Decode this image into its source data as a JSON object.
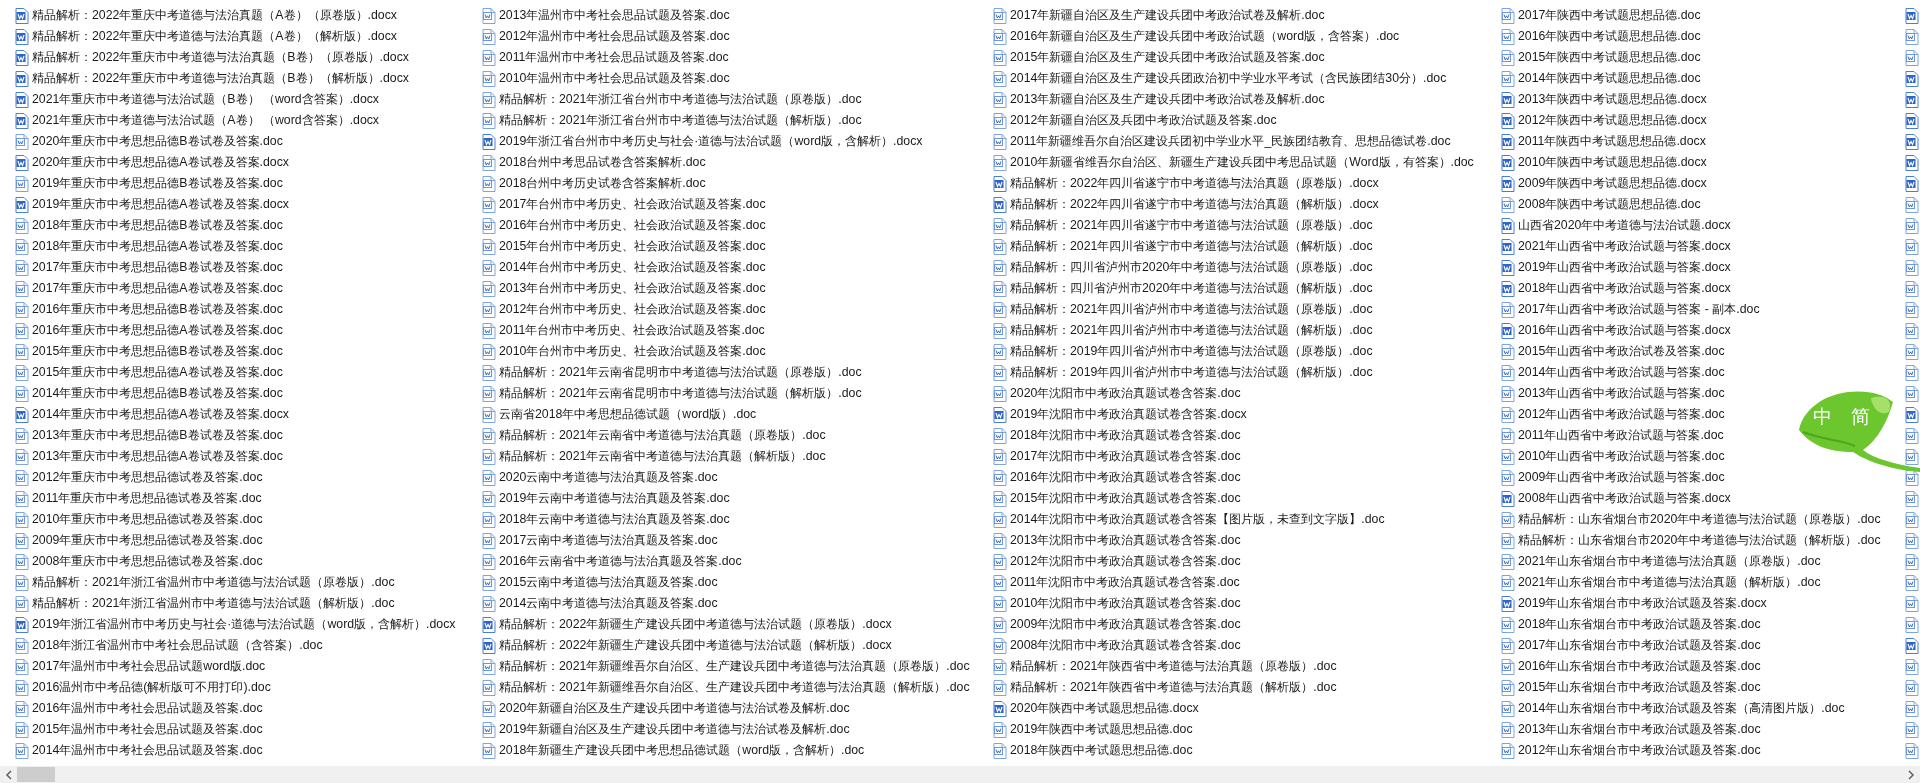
{
  "file_columns": [
    {
      "files": [
        {
          "name": "精品解析：2022年重庆中考道德与法治真题（A卷）（原卷版）.docx",
          "kind": "filled"
        },
        {
          "name": "精品解析：2022年重庆中考道德与法治真题（A卷）（解析版）.docx",
          "kind": "filled"
        },
        {
          "name": "精品解析：2022年重庆市中考道德与法治真题（B卷）（原卷版）.docx",
          "kind": "filled"
        },
        {
          "name": "精品解析：2022年重庆市中考道德与法治真题（B卷）（解析版）.docx",
          "kind": "filled"
        },
        {
          "name": "2021年重庆市中考道德与法治试题（B卷） （word含答案）.docx",
          "kind": "filled"
        },
        {
          "name": "2021年重庆市中考道德与法治试题（A卷） （word含答案）.docx",
          "kind": "filled"
        },
        {
          "name": "2020年重庆市中考思想品德B卷试卷及答案.doc",
          "kind": "outline"
        },
        {
          "name": "2020年重庆市中考思想品德A卷试卷及答案.docx",
          "kind": "filled"
        },
        {
          "name": "2019年重庆市中考思想品德B卷试卷及答案.doc",
          "kind": "outline"
        },
        {
          "name": "2019年重庆市中考思想品德A卷试卷及答案.docx",
          "kind": "filled"
        },
        {
          "name": "2018年重庆市中考思想品德B卷试卷及答案.doc",
          "kind": "outline"
        },
        {
          "name": "2018年重庆市中考思想品德A卷试卷及答案.doc",
          "kind": "outline"
        },
        {
          "name": "2017年重庆市中考思想品德B卷试卷及答案.doc",
          "kind": "outline"
        },
        {
          "name": "2017年重庆市中考思想品德A卷试卷及答案.doc",
          "kind": "outline"
        },
        {
          "name": "2016年重庆市中考思想品德B卷试卷及答案.doc",
          "kind": "outline"
        },
        {
          "name": "2016年重庆市中考思想品德A卷试卷及答案.doc",
          "kind": "outline"
        },
        {
          "name": "2015年重庆市中考思想品德B卷试卷及答案.doc",
          "kind": "outline"
        },
        {
          "name": "2015年重庆市中考思想品德A卷试卷及答案.doc",
          "kind": "outline"
        },
        {
          "name": "2014年重庆市中考思想品德B卷试卷及答案.doc",
          "kind": "outline"
        },
        {
          "name": "2014年重庆市中考思想品德A卷试卷及答案.docx",
          "kind": "filled"
        },
        {
          "name": "2013年重庆市中考思想品德B卷试卷及答案.doc",
          "kind": "outline"
        },
        {
          "name": "2013年重庆市中考思想品德A卷试卷及答案.doc",
          "kind": "outline"
        },
        {
          "name": "2012年重庆市中考思想品德试卷及答案.doc",
          "kind": "outline"
        },
        {
          "name": "2011年重庆市中考思想品德试卷及答案.doc",
          "kind": "outline"
        },
        {
          "name": "2010年重庆市中考思想品德试卷及答案.doc",
          "kind": "outline"
        },
        {
          "name": "2009年重庆市中考思想品德试卷及答案.doc",
          "kind": "outline"
        },
        {
          "name": "2008年重庆市中考思想品德试卷及答案.doc",
          "kind": "outline"
        },
        {
          "name": "精品解析：2021年浙江省温州市中考道德与法治试题（原卷版）.doc",
          "kind": "outline"
        },
        {
          "name": "精品解析：2021年浙江省温州市中考道德与法治试题（解析版）.doc",
          "kind": "outline"
        },
        {
          "name": "2019年浙江省温州市中考历史与社会·道德与法治试题（word版，含解析）.docx",
          "kind": "filled"
        },
        {
          "name": "2018年浙江省温州市中考社会思品试题（含答案）.doc",
          "kind": "outline"
        },
        {
          "name": "2017年温州市中考社会思品试题word版.doc",
          "kind": "outline"
        },
        {
          "name": "2016温州市中考品德(解析版可不用打印).doc",
          "kind": "outline"
        },
        {
          "name": "2016年温州市中考社会思品试题及答案.doc",
          "kind": "outline"
        },
        {
          "name": "2015年温州市中考社会思品试题及答案.doc",
          "kind": "outline"
        },
        {
          "name": "2014年温州市中考社会思品试题及答案.doc",
          "kind": "outline"
        }
      ]
    },
    {
      "files": [
        {
          "name": "2013年温州市中考社会思品试题及答案.doc",
          "kind": "outline"
        },
        {
          "name": "2012年温州市中考社会思品试题及答案.doc",
          "kind": "outline"
        },
        {
          "name": "2011年温州市中考社会思品试题及答案.doc",
          "kind": "outline"
        },
        {
          "name": "2010年温州市中考社会思品试题及答案.doc",
          "kind": "outline"
        },
        {
          "name": "精品解析：2021年浙江省台州市中考道德与法治试题（原卷版）.doc",
          "kind": "outline"
        },
        {
          "name": "精品解析：2021年浙江省台州市中考道德与法治试题（解析版）.doc",
          "kind": "outline"
        },
        {
          "name": "2019年浙江省台州市中考历史与社会·道德与法治试题（word版，含解析）.docx",
          "kind": "filled"
        },
        {
          "name": "2018台州中考思品试卷含答案解析.doc",
          "kind": "outline"
        },
        {
          "name": "2018台州中考历史试卷含答案解析.doc",
          "kind": "outline"
        },
        {
          "name": "2017年台州市中考历史、社会政治试题及答案.doc",
          "kind": "outline"
        },
        {
          "name": "2016年台州市中考历史、社会政治试题及答案.doc",
          "kind": "outline"
        },
        {
          "name": "2015年台州市中考历史、社会政治试题及答案.doc",
          "kind": "outline"
        },
        {
          "name": "2014年台州市中考历史、社会政治试题及答案.doc",
          "kind": "outline"
        },
        {
          "name": "2013年台州市中考历史、社会政治试题及答案.doc",
          "kind": "outline"
        },
        {
          "name": "2012年台州市中考历史、社会政治试题及答案.doc",
          "kind": "outline"
        },
        {
          "name": "2011年台州市中考历史、社会政治试题及答案.doc",
          "kind": "outline"
        },
        {
          "name": "2010年台州市中考历史、社会政治试题及答案.doc",
          "kind": "outline"
        },
        {
          "name": "精品解析：2021年云南省昆明市中考道德与法治试题（原卷版）.doc",
          "kind": "outline"
        },
        {
          "name": "精品解析：2021年云南省昆明市中考道德与法治试题（解析版）.doc",
          "kind": "outline"
        },
        {
          "name": "云南省2018年中考思想品德试题（word版）.doc",
          "kind": "outline"
        },
        {
          "name": "精品解析：2021年云南省中考道德与法治真题（原卷版）.doc",
          "kind": "outline"
        },
        {
          "name": "精品解析：2021年云南省中考道德与法治真题（解析版）.doc",
          "kind": "outline"
        },
        {
          "name": "2020云南中考道德与法治真题及答案.doc",
          "kind": "outline"
        },
        {
          "name": "2019年云南中考道德与法治真题及答案.doc",
          "kind": "outline"
        },
        {
          "name": "2018年云南中考道德与法治真题及答案.doc",
          "kind": "outline"
        },
        {
          "name": "2017云南中考道德与法治真题及答案.doc",
          "kind": "outline"
        },
        {
          "name": "2016年云南省中考道德与法治真题及答案.doc",
          "kind": "outline"
        },
        {
          "name": "2015云南中考道德与法治真题及答案.doc",
          "kind": "outline"
        },
        {
          "name": "2014云南中考道德与法治真题及答案.doc",
          "kind": "outline"
        },
        {
          "name": "精品解析：2022年新疆生产建设兵团中考道德与法治试题（原卷版）.docx",
          "kind": "filled"
        },
        {
          "name": "精品解析：2022年新疆生产建设兵团中考道德与法治试题（解析版）.docx",
          "kind": "filled"
        },
        {
          "name": "精品解析：2021年新疆维吾尔自治区、生产建设兵团中考道德与法治真题（原卷版）.doc",
          "kind": "outline"
        },
        {
          "name": "精品解析：2021年新疆维吾尔自治区、生产建设兵团中考道德与法治真题（解析版）.doc",
          "kind": "outline"
        },
        {
          "name": "2020年新疆自治区及生产建设兵团中考道德与法治试卷及解析.doc",
          "kind": "outline"
        },
        {
          "name": "2019年新疆自治区及生产建设兵团中考道德与法治试卷及解析.doc",
          "kind": "outline"
        },
        {
          "name": "2018年新疆生产建设兵团中考思想品德试题（word版，含解析）.doc",
          "kind": "outline"
        }
      ]
    },
    {
      "files": [
        {
          "name": "2017年新疆自治区及生产建设兵团中考政治试卷及解析.doc",
          "kind": "outline"
        },
        {
          "name": "2016年新疆自治区及生产建设兵团中考政治试题（word版，含答案）.doc",
          "kind": "outline"
        },
        {
          "name": "2015年新疆自治区及生产建设兵团中考政治试题及答案.doc",
          "kind": "outline"
        },
        {
          "name": "2014年新疆自治区及生产建设兵团政治初中学业水平考试（含民族团结30分）.doc",
          "kind": "outline"
        },
        {
          "name": "2013年新疆自治区及生产建设兵团中考政治试卷及解析.doc",
          "kind": "outline"
        },
        {
          "name": "2012年新疆自治区及兵团中考政治试题及答案.doc",
          "kind": "outline"
        },
        {
          "name": "2011年新疆维吾尔自治区建设兵团初中学业水平_民族团结教育、思想品德试卷.doc",
          "kind": "outline"
        },
        {
          "name": "2010年新疆省维吾尔自治区、新疆生产建设兵团中考思品试题（Word版，有答案）.doc",
          "kind": "outline"
        },
        {
          "name": "精品解析：2022年四川省遂宁市中考道德与法治真题（原卷版）.docx",
          "kind": "filled"
        },
        {
          "name": "精品解析：2022年四川省遂宁市中考道德与法治真题（解析版）.docx",
          "kind": "filled"
        },
        {
          "name": "精品解析：2021年四川省遂宁市中考道德与法治试题（原卷版）.doc",
          "kind": "outline"
        },
        {
          "name": "精品解析：2021年四川省遂宁市中考道德与法治试题（解析版）.doc",
          "kind": "outline"
        },
        {
          "name": "精品解析：四川省泸州市2020年中考道德与法治试题（原卷版）.doc",
          "kind": "outline"
        },
        {
          "name": "精品解析：四川省泸州市2020年中考道德与法治试题（解析版）.doc",
          "kind": "outline"
        },
        {
          "name": "精品解析：2021年四川省泸州市中考道德与法治试题（原卷版）.doc",
          "kind": "outline"
        },
        {
          "name": "精品解析：2021年四川省泸州市中考道德与法治试题（解析版）.doc",
          "kind": "outline"
        },
        {
          "name": "精品解析：2019年四川省泸州市中考道德与法治试题（原卷版）.doc",
          "kind": "outline"
        },
        {
          "name": "精品解析：2019年四川省泸州市中考道德与法治试题（解析版）.doc",
          "kind": "outline"
        },
        {
          "name": "2020年沈阳市中考政治真题试卷含答案.doc",
          "kind": "outline"
        },
        {
          "name": "2019年沈阳市中考政治真题试卷含答案.docx",
          "kind": "filled"
        },
        {
          "name": "2018年沈阳市中考政治真题试卷含答案.doc",
          "kind": "outline"
        },
        {
          "name": "2017年沈阳市中考政治真题试卷含答案.doc",
          "kind": "outline"
        },
        {
          "name": "2016年沈阳市中考政治真题试卷含答案.doc",
          "kind": "outline"
        },
        {
          "name": "2015年沈阳市中考政治真题试卷含答案.doc",
          "kind": "outline"
        },
        {
          "name": "2014年沈阳市中考政治真题试卷含答案【图片版，未查到文字版】.doc",
          "kind": "outline"
        },
        {
          "name": "2013年沈阳市中考政治真题试卷含答案.doc",
          "kind": "outline"
        },
        {
          "name": "2012年沈阳市中考政治真题试卷含答案.doc",
          "kind": "outline"
        },
        {
          "name": "2011年沈阳市中考政治真题试卷含答案.doc",
          "kind": "outline"
        },
        {
          "name": "2010年沈阳市中考政治真题试卷含答案.doc",
          "kind": "outline"
        },
        {
          "name": "2009年沈阳市中考政治真题试卷含答案.doc",
          "kind": "outline"
        },
        {
          "name": "2008年沈阳市中考政治真题试卷含答案.doc",
          "kind": "outline"
        },
        {
          "name": "精品解析：2021年陕西省中考道德与法治真题（原卷版）.doc",
          "kind": "outline"
        },
        {
          "name": "精品解析：2021年陕西省中考道德与法治真题（解析版）.doc",
          "kind": "outline"
        },
        {
          "name": "2020年陕西中考试题思想品德.docx",
          "kind": "filled"
        },
        {
          "name": "2019年陕西中考试题思想品德.doc",
          "kind": "outline"
        },
        {
          "name": "2018年陕西中考试题思想品德.doc",
          "kind": "outline"
        }
      ]
    },
    {
      "files": [
        {
          "name": "2017年陕西中考试题思想品德.doc",
          "kind": "outline"
        },
        {
          "name": "2016年陕西中考试题思想品德.doc",
          "kind": "outline"
        },
        {
          "name": "2015年陕西中考试题思想品德.doc",
          "kind": "outline"
        },
        {
          "name": "2014年陕西中考试题思想品德.doc",
          "kind": "outline"
        },
        {
          "name": "2013年陕西中考试题思想品德.docx",
          "kind": "filled"
        },
        {
          "name": "2012年陕西中考试题思想品德.docx",
          "kind": "filled"
        },
        {
          "name": "2011年陕西中考试题思想品德.docx",
          "kind": "filled"
        },
        {
          "name": "2010年陕西中考试题思想品德.docx",
          "kind": "filled"
        },
        {
          "name": "2009年陕西中考试题思想品德.docx",
          "kind": "filled"
        },
        {
          "name": "2008年陕西中考试题思想品德.doc",
          "kind": "outline"
        },
        {
          "name": "山西省2020年中考道德与法治试题.docx",
          "kind": "filled"
        },
        {
          "name": "2021年山西省中考政治试题与答案.docx",
          "kind": "filled"
        },
        {
          "name": "2019年山西省中考政治试题与答案.docx",
          "kind": "filled"
        },
        {
          "name": "2018年山西省中考政治试题与答案.docx",
          "kind": "filled"
        },
        {
          "name": "2017年山西省中考政治试题与答案 - 副本.doc",
          "kind": "outline"
        },
        {
          "name": "2016年山西省中考政治试题与答案.docx",
          "kind": "filled"
        },
        {
          "name": "2015年山西省中考政治试卷及答案.doc",
          "kind": "outline"
        },
        {
          "name": "2014年山西省中考政治试题与答案.doc",
          "kind": "outline"
        },
        {
          "name": "2013年山西省中考政治试题与答案.doc",
          "kind": "outline"
        },
        {
          "name": "2012年山西省中考政治试题与答案.doc",
          "kind": "outline"
        },
        {
          "name": "2011年山西省中考政治试题与答案.doc",
          "kind": "outline"
        },
        {
          "name": "2010年山西省中考政治试题与答案.doc",
          "kind": "outline"
        },
        {
          "name": "2009年山西省中考政治试题与答案.doc",
          "kind": "outline"
        },
        {
          "name": "2008年山西省中考政治试题与答案.docx",
          "kind": "filled"
        },
        {
          "name": "精品解析：山东省烟台市2020年中考道德与法治试题（原卷版）.doc",
          "kind": "outline"
        },
        {
          "name": "精品解析：山东省烟台市2020年中考道德与法治试题（解析版）.doc",
          "kind": "outline"
        },
        {
          "name": "2021年山东省烟台市中考道德与法治真题（原卷版）.doc",
          "kind": "outline"
        },
        {
          "name": "2021年山东省烟台市中考道德与法治真题（解析版）.doc",
          "kind": "outline"
        },
        {
          "name": "2019年山东省烟台市中考政治试题及答案.docx",
          "kind": "filled"
        },
        {
          "name": "2018年山东省烟台市中考政治试题及答案.doc",
          "kind": "outline"
        },
        {
          "name": "2017年山东省烟台市中考政治试题及答案.doc",
          "kind": "outline"
        },
        {
          "name": "2016年山东省烟台市中考政治试题及答案.doc",
          "kind": "outline"
        },
        {
          "name": "2015年山东省烟台市中考政治试题及答案.doc",
          "kind": "outline"
        },
        {
          "name": "2014年山东省烟台市中考政治试题及答案（高清图片版）.doc",
          "kind": "outline"
        },
        {
          "name": "2013年山东省烟台市中考政治试题及答案.doc",
          "kind": "outline"
        },
        {
          "name": "2012年山东省烟台市中考政治试题及答案.doc",
          "kind": "outline"
        }
      ]
    }
  ],
  "column_5": [
    {
      "kind": "filled"
    },
    {
      "kind": "outline"
    },
    {
      "kind": "outline"
    },
    {
      "kind": "filled"
    },
    {
      "kind": "filled"
    },
    {
      "kind": "filled"
    },
    {
      "kind": "filled"
    },
    {
      "kind": "filled"
    },
    {
      "kind": "filled"
    },
    {
      "kind": "outline"
    },
    {
      "kind": "outline"
    },
    {
      "kind": "outline"
    },
    {
      "kind": "outline"
    },
    {
      "kind": "outline"
    },
    {
      "kind": "outline"
    },
    {
      "kind": "outline"
    },
    {
      "kind": "outline"
    },
    {
      "kind": "outline"
    },
    {
      "kind": "outline"
    },
    {
      "kind": "filled"
    },
    {
      "kind": "outline"
    },
    {
      "kind": "outline"
    },
    {
      "kind": "outline"
    },
    {
      "kind": "outline"
    },
    {
      "kind": "outline"
    },
    {
      "kind": "outline"
    },
    {
      "kind": "outline"
    },
    {
      "kind": "outline"
    },
    {
      "kind": "outline"
    },
    {
      "kind": "outline"
    },
    {
      "kind": "filled"
    },
    {
      "kind": "outline"
    },
    {
      "kind": "outline"
    },
    {
      "kind": "outline"
    },
    {
      "kind": "outline"
    },
    {
      "kind": "outline"
    }
  ],
  "ime_widget": {
    "modes": [
      "中",
      "简"
    ]
  }
}
